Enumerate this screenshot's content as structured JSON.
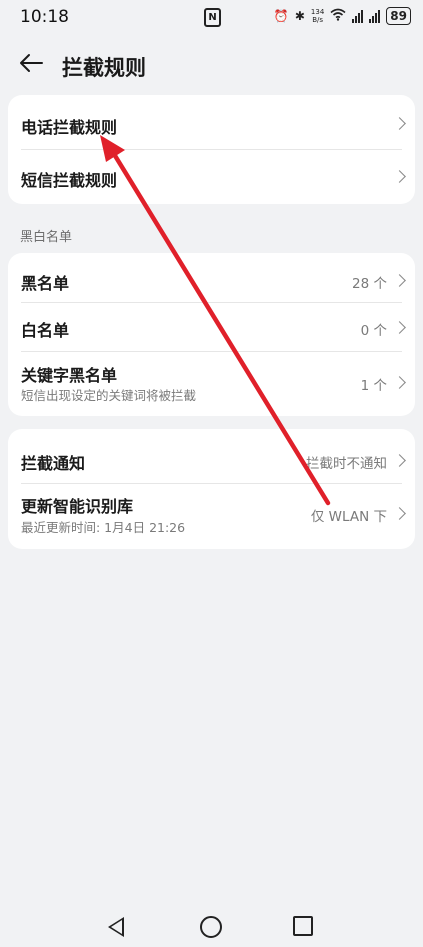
{
  "status_bar": {
    "time": "10:18",
    "net_speed_top": "134",
    "net_speed_bottom": "B/s",
    "battery": "89"
  },
  "header": {
    "title": "拦截规则"
  },
  "card1": {
    "items": [
      {
        "label": "电话拦截规则"
      },
      {
        "label": "短信拦截规则"
      }
    ]
  },
  "section_blacklist": {
    "title": "黑白名单"
  },
  "card2": {
    "items": [
      {
        "label": "黑名单",
        "value": "28 个"
      },
      {
        "label": "白名单",
        "value": "0 个"
      },
      {
        "label": "关键字黑名单",
        "subtitle": "短信出现设定的关键词将被拦截",
        "value": "1 个"
      }
    ]
  },
  "card3": {
    "items": [
      {
        "label": "拦截通知",
        "value": "拦截时不通知"
      },
      {
        "label": "更新智能识别库",
        "subtitle": "最近更新时间: 1月4日 21:26",
        "value": "仅 WLAN 下"
      }
    ]
  },
  "colors": {
    "background": "#f1f2f4",
    "card": "#ffffff",
    "annotation_arrow": "#e0202a"
  },
  "icons": [
    "back-arrow-icon",
    "chevron-right-icon",
    "nfc-icon",
    "alarm-icon",
    "bluetooth-icon",
    "wifi-icon",
    "signal-icon",
    "battery-icon",
    "nav-back-icon",
    "nav-home-icon",
    "nav-recents-icon"
  ]
}
